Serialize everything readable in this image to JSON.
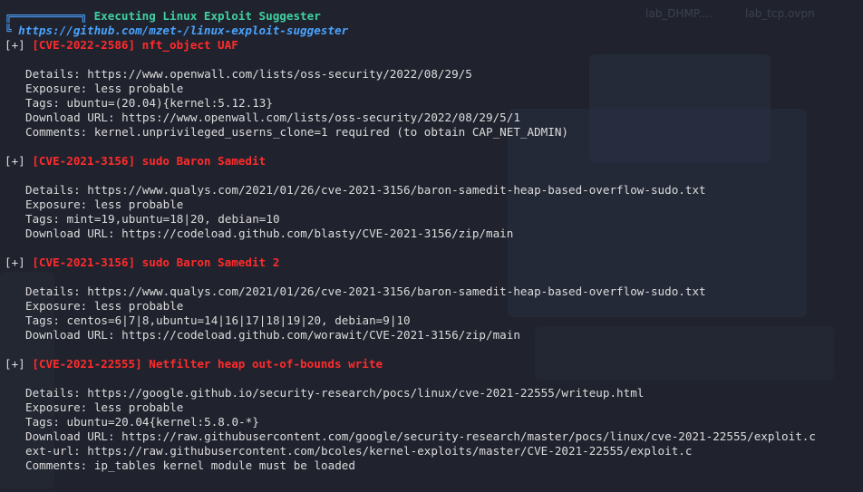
{
  "desktop": {
    "icons": [
      "lab_DHMP.…",
      "lab_tcp.ovpn"
    ]
  },
  "header": {
    "title": "Executing Linux Exploit Suggester",
    "url": "https://github.com/mzet-/linux-exploit-suggester"
  },
  "entries": [
    {
      "marker": "[+]",
      "title": "[CVE-2022-2586] nft_object UAF",
      "lines": [
        "Details: https://www.openwall.com/lists/oss-security/2022/08/29/5",
        "Exposure: less probable",
        "Tags: ubuntu=(20.04){kernel:5.12.13}",
        "Download URL: https://www.openwall.com/lists/oss-security/2022/08/29/5/1",
        "Comments: kernel.unprivileged_userns_clone=1 required (to obtain CAP_NET_ADMIN)"
      ]
    },
    {
      "marker": "[+]",
      "title": "[CVE-2021-3156] sudo Baron Samedit",
      "lines": [
        "Details: https://www.qualys.com/2021/01/26/cve-2021-3156/baron-samedit-heap-based-overflow-sudo.txt",
        "Exposure: less probable",
        "Tags: mint=19,ubuntu=18|20, debian=10",
        "Download URL: https://codeload.github.com/blasty/CVE-2021-3156/zip/main"
      ]
    },
    {
      "marker": "[+]",
      "title": "[CVE-2021-3156] sudo Baron Samedit 2",
      "lines": [
        "Details: https://www.qualys.com/2021/01/26/cve-2021-3156/baron-samedit-heap-based-overflow-sudo.txt",
        "Exposure: less probable",
        "Tags: centos=6|7|8,ubuntu=14|16|17|18|19|20, debian=9|10",
        "Download URL: https://codeload.github.com/worawit/CVE-2021-3156/zip/main"
      ]
    },
    {
      "marker": "[+]",
      "title": "[CVE-2021-22555] Netfilter heap out-of-bounds write",
      "lines": [
        "Details: https://google.github.io/security-research/pocs/linux/cve-2021-22555/writeup.html",
        "Exposure: less probable",
        "Tags: ubuntu=20.04{kernel:5.8.0-*}",
        "Download URL: https://raw.githubusercontent.com/google/security-research/master/pocs/linux/cve-2021-22555/exploit.c",
        "ext-url: https://raw.githubusercontent.com/bcoles/kernel-exploits/master/CVE-2021-22555/exploit.c",
        "Comments: ip_tables kernel module must be loaded"
      ]
    }
  ]
}
